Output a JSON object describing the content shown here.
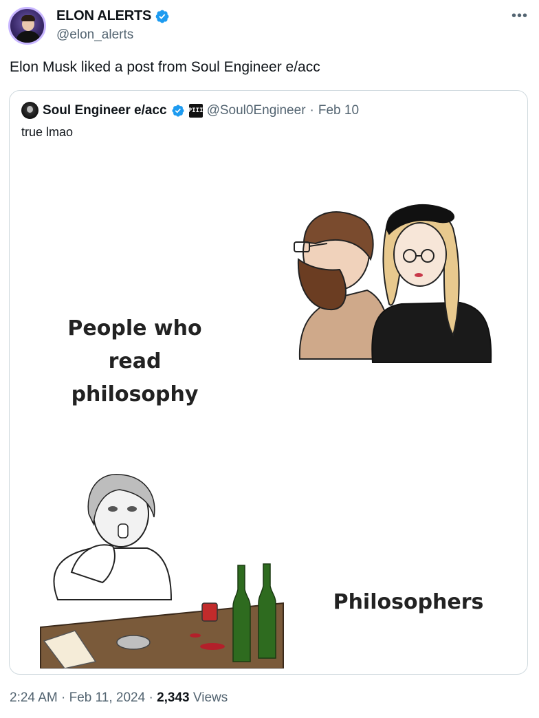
{
  "author": {
    "display_name": "ELON ALERTS",
    "handle": "@elon_alerts",
    "verified": true
  },
  "menu_icon": "more-horizontal-icon",
  "post_text": "Elon Musk liked a post from Soul Engineer e/acc",
  "quoted_post": {
    "display_name": "Soul Engineer e/acc",
    "verified": true,
    "affiliate_badge": "PIII",
    "handle": "@Soul0Engineer",
    "separator": "·",
    "date": "Feb 10",
    "text": "true lmao",
    "meme": {
      "label_top_line1": "People who read",
      "label_top_line2": "philosophy",
      "label_bottom": "Philosophers"
    }
  },
  "footer": {
    "time": "2:24 AM",
    "sep1": "·",
    "date": "Feb 11, 2024",
    "sep2": "·",
    "views_count": "2,343",
    "views_label": "Views"
  },
  "colors": {
    "verified_blue": "#1d9bf0",
    "secondary_text": "#536471",
    "border": "#cfd9de"
  }
}
